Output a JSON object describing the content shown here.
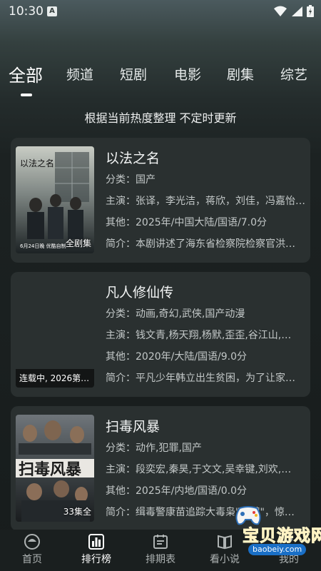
{
  "status_bar": {
    "time": "10:30",
    "notification_letter": "A"
  },
  "tabs": [
    {
      "label": "全部",
      "active": true
    },
    {
      "label": "频道"
    },
    {
      "label": "短剧"
    },
    {
      "label": "电影"
    },
    {
      "label": "剧集"
    },
    {
      "label": "综艺"
    }
  ],
  "subtitle": "根据当前热度整理 不定时更新",
  "items": [
    {
      "title": "以法之名",
      "category": "分类：国产",
      "cast": "主演：张译，李光洁，蒋欣，刘佳，冯嘉怡…",
      "other": "其他：2025年/中国大陆/国语/7.0分",
      "intro": "简介：本剧讲述了海东省检察院检察官洪…",
      "badge": "全剧集",
      "poster_title": "以法之名",
      "poster_caption": "6月24日晚 优酷自制"
    },
    {
      "title": "凡人修仙传",
      "category": "分类：动画,奇幻,武侠,国产动漫",
      "cast": "主演：钱文青,杨天翔,杨默,歪歪,谷江山,…",
      "other": "其他：2020年/大陆/国语/9.0分",
      "intro": "简介：平凡少年韩立出生贫困，为了让家…",
      "badge": "连载中, 2026第…"
    },
    {
      "title": "扫毒风暴",
      "category": "分类：动作,犯罪,国产",
      "cast": "主演：段奕宏,秦昊,于文文,吴幸键,刘欢,…",
      "other": "其他：2025年/内地/国语/0.0分",
      "intro": "简介：缉毒警康苗追踪大毒枭\"老鹞\"，惊…",
      "badge": "33集全",
      "poster_title": "扫毒风暴"
    }
  ],
  "bottom_nav": [
    {
      "label": "首页",
      "icon": "home-icon"
    },
    {
      "label": "排行榜",
      "icon": "ranking-icon",
      "active": true
    },
    {
      "label": "排期表",
      "icon": "calendar-icon"
    },
    {
      "label": "看小说",
      "icon": "book-icon"
    },
    {
      "label": "我的",
      "icon": "profile-icon"
    }
  ],
  "watermark": {
    "text": "宝贝游戏网",
    "url": "baobeiy.com"
  }
}
